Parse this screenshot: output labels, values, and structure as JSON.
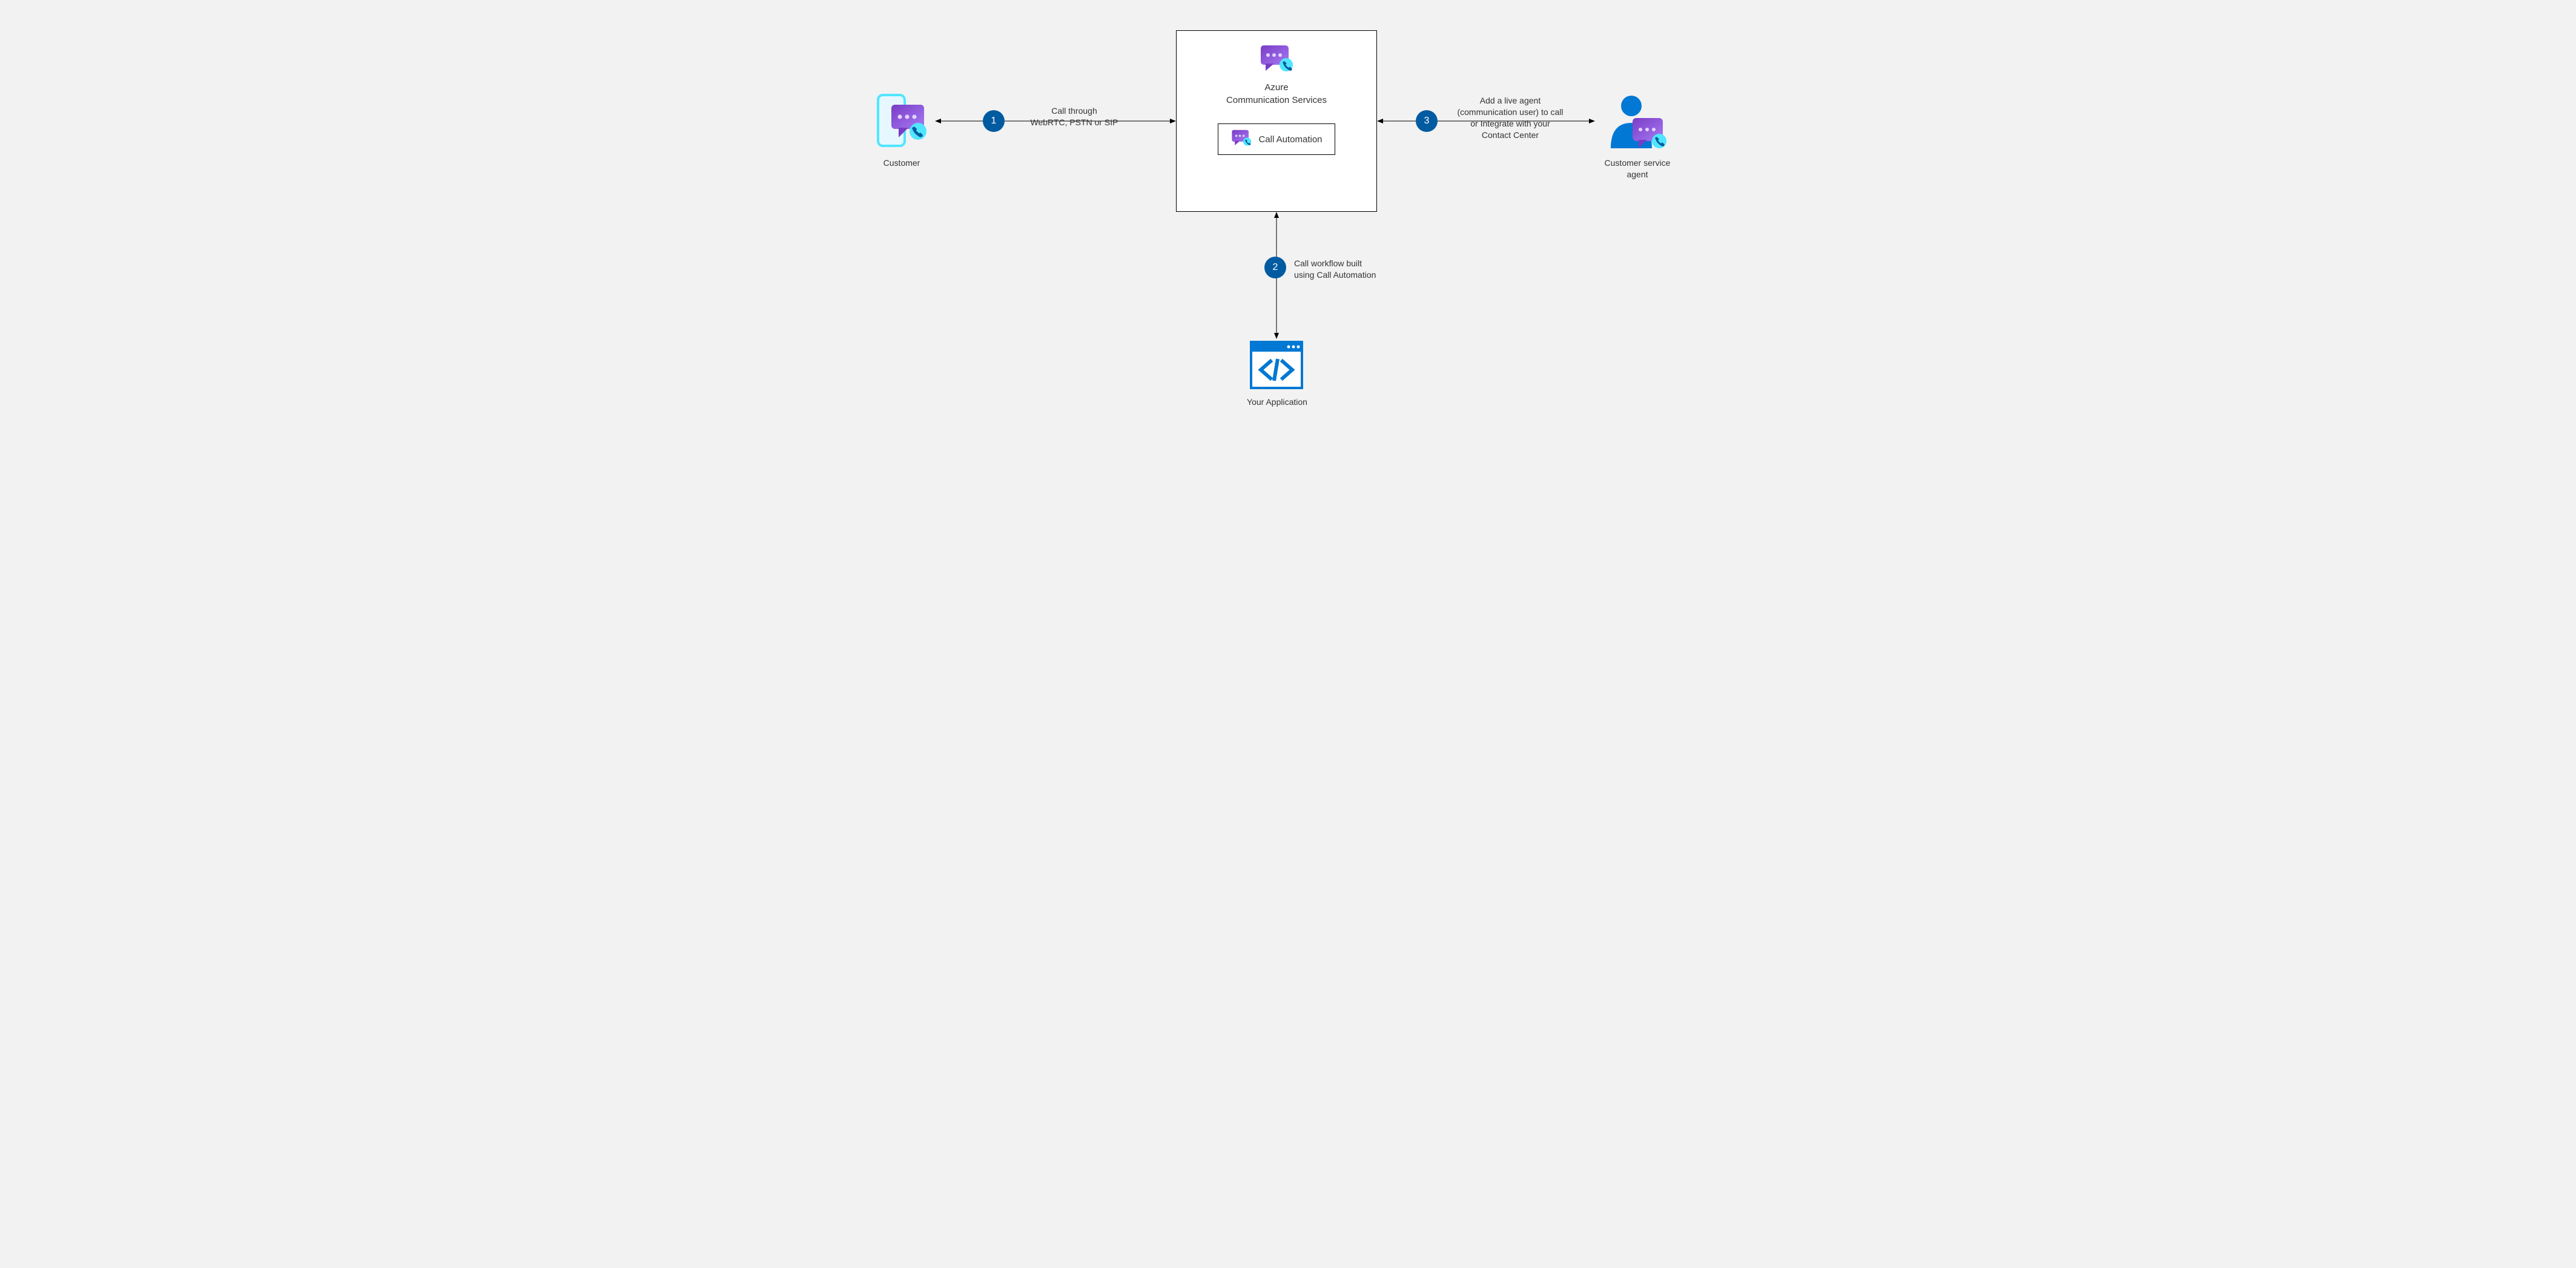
{
  "nodes": {
    "customer": {
      "label": "Customer"
    },
    "acs": {
      "line1": "Azure",
      "line2": "Communication Services"
    },
    "call_automation": {
      "label": "Call Automation"
    },
    "agent": {
      "line1": "Customer service",
      "line2": "agent"
    },
    "your_app": {
      "label": "Your Application"
    }
  },
  "steps": [
    {
      "num": "1",
      "text_line1": "Call through",
      "text_line2": "WebRTC, PSTN or SIP"
    },
    {
      "num": "2",
      "text_line1": "Call workflow built",
      "text_line2": "using Call Automation"
    },
    {
      "num": "3",
      "text_line1": "Add a live agent",
      "text_line2": "(communication user) to call",
      "text_line3": "or Integrate with your",
      "text_line4": "Contact Center"
    }
  ],
  "colors": {
    "step_circle": "#005ba1",
    "azure_blue": "#0078d4",
    "purple_dark": "#7a3cc5",
    "purple_light": "#a67af4",
    "cyan": "#50e6ff",
    "bg": "#f2f2f2"
  }
}
